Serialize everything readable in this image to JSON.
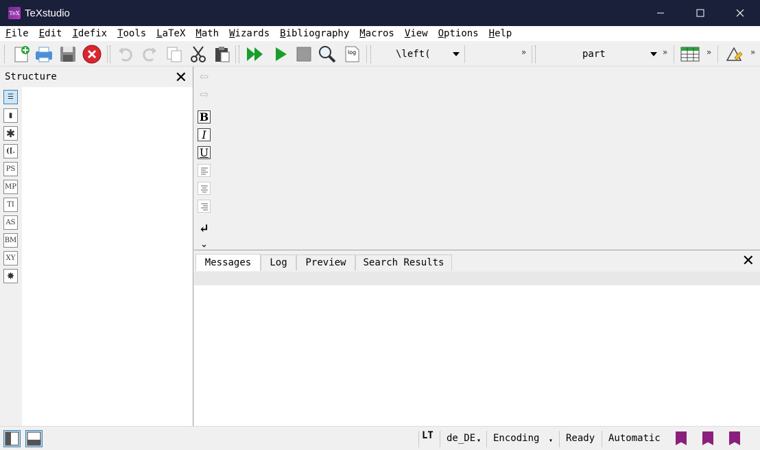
{
  "window": {
    "title": "TeXstudio",
    "app_icon_text": "TeX",
    "controls": {
      "minimize": "—",
      "maximize": "☐",
      "close": "✕"
    }
  },
  "menu": [
    "File",
    "Edit",
    "Idefix",
    "Tools",
    "LaTeX",
    "Math",
    "Wizards",
    "Bibliography",
    "Macros",
    "View",
    "Options",
    "Help"
  ],
  "toolbar": {
    "left_bracket_combo": "\\left(",
    "section_combo": "part",
    "overflow": "»",
    "log_label": "log"
  },
  "structure_panel": {
    "title": "Structure",
    "close": "✕",
    "rail_buttons": [
      "☰",
      "▮",
      "✱",
      "([.",
      "PS",
      "MP",
      "TI",
      "AS",
      "BM",
      "XY",
      "✸"
    ]
  },
  "format_tools": {
    "back": "⇦",
    "forward": "⇨",
    "bold": "B",
    "italic": "I",
    "underline": "U",
    "newline": "↵",
    "more": "⌄"
  },
  "bottom_panel": {
    "tabs": [
      "Messages",
      "Log",
      "Preview",
      "Search Results"
    ],
    "active_tab": "Messages",
    "close": "✕"
  },
  "status": {
    "lt_label": "LT",
    "language": "de_DE",
    "encoding": "Encoding",
    "ready": "Ready",
    "mode": "Automatic"
  },
  "colors": {
    "titlebar": "#1a1f3a",
    "run_green": "#1a9e2a",
    "stop_red": "#d9262f",
    "bookmark": "#8b1f7c"
  }
}
